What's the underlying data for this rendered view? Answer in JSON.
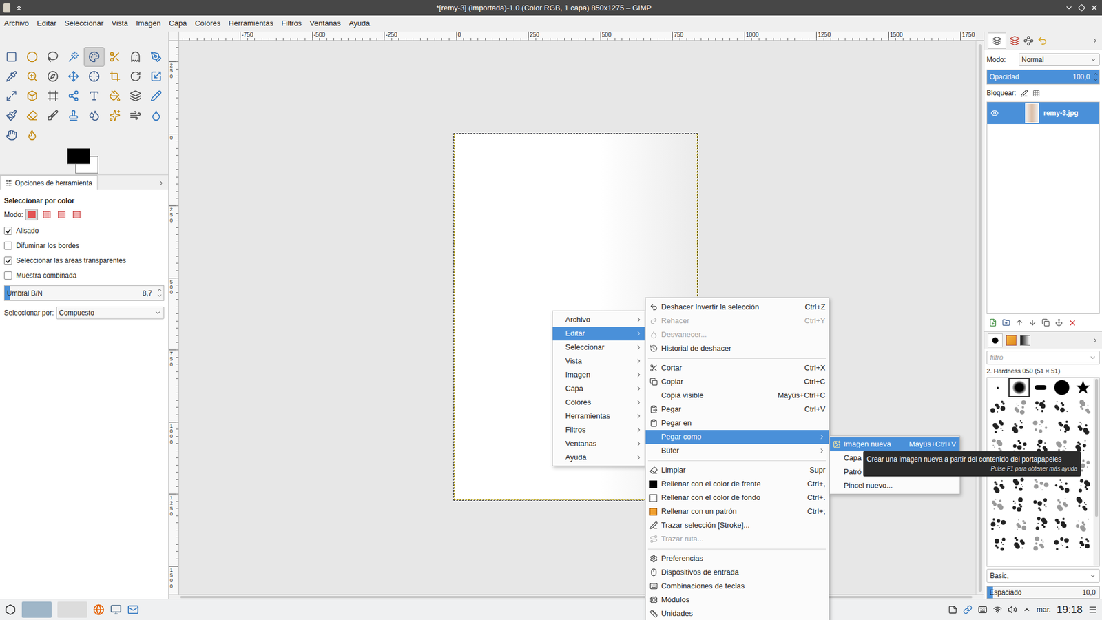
{
  "window": {
    "title": "*[remy-3] (importada)-1.0 (Color RGB, 1 capa) 850x1275 – GIMP"
  },
  "menubar": [
    "Archivo",
    "Editar",
    "Seleccionar",
    "Vista",
    "Imagen",
    "Capa",
    "Colores",
    "Herramientas",
    "Filtros",
    "Ventanas",
    "Ayuda"
  ],
  "toolbox": {
    "tools": [
      {
        "selected": false
      },
      {
        "selected": false
      },
      {
        "selected": false
      },
      {
        "selected": false
      },
      {
        "selected": true
      },
      {
        "selected": false
      },
      {
        "selected": false
      },
      {
        "selected": false
      },
      {
        "selected": false
      },
      {
        "selected": false
      },
      {
        "selected": false
      },
      {
        "selected": false
      },
      {
        "selected": false
      },
      {
        "selected": false
      },
      {
        "selected": false
      },
      {
        "selected": false
      },
      {
        "selected": false
      },
      {
        "selected": false
      },
      {
        "selected": false
      },
      {
        "selected": false
      },
      {
        "selected": false
      },
      {
        "selected": false
      },
      {
        "selected": false
      },
      {
        "selected": false
      },
      {
        "selected": false
      },
      {
        "selected": false
      },
      {
        "selected": false
      },
      {
        "selected": false
      },
      {
        "selected": false
      },
      {
        "selected": false
      },
      {
        "selected": false
      },
      {
        "selected": false
      },
      {
        "selected": false
      },
      {
        "selected": false
      }
    ],
    "swatches": [
      {
        "color": "#000000"
      },
      {
        "color": "#ffffff"
      }
    ]
  },
  "tool_options": {
    "tab": "Opciones de herramienta",
    "title": "Seleccionar por color",
    "mode_label": "Modo:",
    "modes": [
      {
        "selected": true
      },
      {
        "selected": false
      },
      {
        "selected": false
      },
      {
        "selected": false
      }
    ],
    "checkboxes": [
      {
        "label": "Alisado",
        "checked": true
      },
      {
        "label": "Difuminar los bordes",
        "checked": false
      },
      {
        "label": "Seleccionar las áreas transparentes",
        "checked": true
      },
      {
        "label": "Muestra combinada",
        "checked": false
      }
    ],
    "threshold": {
      "label": "Umbral B/N",
      "value": "8,7",
      "level": 0.034
    },
    "select_by": {
      "label": "Seleccionar por:",
      "value": "Compuesto"
    }
  },
  "rulers": {
    "top": [
      "-750",
      "-500",
      "-250",
      "0",
      "250",
      "500",
      "750",
      "1000",
      "1250",
      "1500",
      "1750"
    ],
    "left": [
      "250",
      "0",
      "250",
      "500",
      "750",
      "1000",
      "1250",
      "1500"
    ]
  },
  "layers_panel": {
    "mode_label": "Modo:",
    "mode": "Normal",
    "opacity_label": "Opacidad",
    "opacity": "100,0",
    "opacity_level": 1,
    "lock_label": "Bloquear:",
    "layers": [
      {
        "name": "remy-3.jpg",
        "visible": true,
        "selected": true
      }
    ]
  },
  "brushes_panel": {
    "filter_placeholder": "filtro",
    "brush_name": "2. Hardness 050 (51 × 51)",
    "brushes": [
      {
        "selected": false
      },
      {
        "selected": true
      },
      {
        "selected": false
      },
      {
        "selected": false
      },
      {
        "selected": false
      },
      {
        "selected": false
      },
      {
        "selected": false
      },
      {
        "selected": false
      },
      {
        "selected": false
      },
      {
        "selected": false
      },
      {
        "selected": false
      },
      {
        "selected": false
      },
      {
        "selected": false
      },
      {
        "selected": false
      },
      {
        "selected": false
      },
      {
        "selected": false
      },
      {
        "selected": false
      },
      {
        "selected": false
      },
      {
        "selected": false
      },
      {
        "selected": false
      },
      {
        "selected": false
      },
      {
        "selected": false
      },
      {
        "selected": false
      },
      {
        "selected": false
      },
      {
        "selected": false
      },
      {
        "selected": false
      },
      {
        "selected": false
      },
      {
        "selected": false
      },
      {
        "selected": false
      },
      {
        "selected": false
      },
      {
        "selected": false
      },
      {
        "selected": false
      },
      {
        "selected": false
      },
      {
        "selected": false
      },
      {
        "selected": false
      },
      {
        "selected": false
      },
      {
        "selected": false
      },
      {
        "selected": false
      },
      {
        "selected": false
      },
      {
        "selected": false
      },
      {
        "selected": false
      },
      {
        "selected": false
      },
      {
        "selected": false
      },
      {
        "selected": false
      },
      {
        "selected": false
      }
    ],
    "tag": "Basic,",
    "spacing_label": "Espaciado",
    "spacing": "10,0",
    "spacing_level": 0.05
  },
  "context_menu": {
    "main": [
      {
        "label": "Archivo",
        "selected": false
      },
      {
        "label": "Editar",
        "selected": true
      },
      {
        "label": "Seleccionar",
        "selected": false
      },
      {
        "label": "Vista",
        "selected": false
      },
      {
        "label": "Imagen",
        "selected": false
      },
      {
        "label": "Capa",
        "selected": false
      },
      {
        "label": "Colores",
        "selected": false
      },
      {
        "label": "Herramientas",
        "selected": false
      },
      {
        "label": "Filtros",
        "selected": false
      },
      {
        "label": "Ventanas",
        "selected": false
      },
      {
        "label": "Ayuda",
        "selected": false
      }
    ],
    "editar": [
      {
        "kind": "item",
        "label": "Deshacer Invertir la selección",
        "shortcut": "Ctrl+Z",
        "disabled": false,
        "selected": false,
        "submenu": false
      },
      {
        "kind": "item",
        "label": "Rehacer",
        "shortcut": "Ctrl+Y",
        "disabled": true,
        "selected": false,
        "submenu": false
      },
      {
        "kind": "item",
        "label": "Desvanecer...",
        "shortcut": "",
        "disabled": true,
        "selected": false,
        "submenu": false
      },
      {
        "kind": "item",
        "label": "Historial de deshacer",
        "shortcut": "",
        "disabled": false,
        "selected": false,
        "submenu": false
      },
      {
        "kind": "separator",
        "label": "",
        "shortcut": "",
        "disabled": false,
        "selected": false,
        "submenu": false
      },
      {
        "kind": "item",
        "label": "Cortar",
        "shortcut": "Ctrl+X",
        "disabled": false,
        "selected": false,
        "submenu": false
      },
      {
        "kind": "item",
        "label": "Copiar",
        "shortcut": "Ctrl+C",
        "disabled": false,
        "selected": false,
        "submenu": false
      },
      {
        "kind": "item",
        "label": "Copia visible",
        "shortcut": "Mayús+Ctrl+C",
        "disabled": false,
        "selected": false,
        "submenu": false
      },
      {
        "kind": "item",
        "label": "Pegar",
        "shortcut": "Ctrl+V",
        "disabled": false,
        "selected": false,
        "submenu": false
      },
      {
        "kind": "item",
        "label": "Pegar en",
        "shortcut": "",
        "disabled": false,
        "selected": false,
        "submenu": false
      },
      {
        "kind": "item",
        "label": "Pegar como",
        "shortcut": "",
        "disabled": false,
        "selected": true,
        "submenu": true
      },
      {
        "kind": "item",
        "label": "Búfer",
        "shortcut": "",
        "disabled": false,
        "selected": false,
        "submenu": true
      },
      {
        "kind": "separator",
        "label": "",
        "shortcut": "",
        "disabled": false,
        "selected": false,
        "submenu": false
      },
      {
        "kind": "item",
        "label": "Limpiar",
        "shortcut": "Supr",
        "disabled": false,
        "selected": false,
        "submenu": false
      },
      {
        "kind": "item",
        "label": "Rellenar con el color de frente",
        "shortcut": "Ctrl+,",
        "disabled": false,
        "selected": false,
        "submenu": false
      },
      {
        "kind": "item",
        "label": "Rellenar con el color de fondo",
        "shortcut": "Ctrl+.",
        "disabled": false,
        "selected": false,
        "submenu": false
      },
      {
        "kind": "item",
        "label": "Rellenar con un patrón",
        "shortcut": "Ctrl+;",
        "disabled": false,
        "selected": false,
        "submenu": false
      },
      {
        "kind": "item",
        "label": "Trazar selección [Stroke]...",
        "shortcut": "",
        "disabled": false,
        "selected": false,
        "submenu": false
      },
      {
        "kind": "item",
        "label": "Trazar ruta...",
        "shortcut": "",
        "disabled": true,
        "selected": false,
        "submenu": false
      },
      {
        "kind": "separator",
        "label": "",
        "shortcut": "",
        "disabled": false,
        "selected": false,
        "submenu": false
      },
      {
        "kind": "item",
        "label": "Preferencias",
        "shortcut": "",
        "disabled": false,
        "selected": false,
        "submenu": false
      },
      {
        "kind": "item",
        "label": "Dispositivos de entrada",
        "shortcut": "",
        "disabled": false,
        "selected": false,
        "submenu": false
      },
      {
        "kind": "item",
        "label": "Combinaciones de teclas",
        "shortcut": "",
        "disabled": false,
        "selected": false,
        "submenu": false
      },
      {
        "kind": "item",
        "label": "Módulos",
        "shortcut": "",
        "disabled": false,
        "selected": false,
        "submenu": false
      },
      {
        "kind": "item",
        "label": "Unidades",
        "shortcut": "",
        "disabled": false,
        "selected": false,
        "submenu": false
      }
    ],
    "pegar_como": [
      {
        "label": "Imagen nueva",
        "shortcut": "Mayús+Ctrl+V",
        "selected": true
      },
      {
        "label": "Capa",
        "shortcut": "",
        "selected": false
      },
      {
        "label": "Patró",
        "shortcut": "",
        "selected": false
      },
      {
        "label": "Pincel nuevo...",
        "shortcut": "",
        "selected": false
      }
    ]
  },
  "tooltip": {
    "text": "Crear una imagen nueva a partir del contenido del portapapeles",
    "hint": "Pulse F1 para obtener más ayuda"
  },
  "taskbar": {
    "tasks": [
      {
        "selected": true
      },
      {
        "selected": false
      }
    ],
    "day": "mar.",
    "time": "19:18"
  }
}
